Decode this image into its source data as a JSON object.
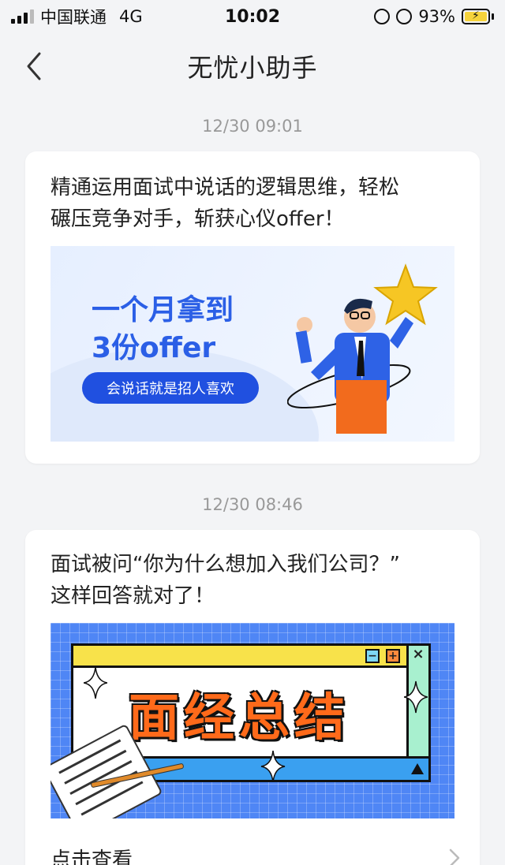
{
  "status_bar": {
    "carrier": "中国联通",
    "network": "4G",
    "time": "10:02",
    "battery": "93%"
  },
  "nav": {
    "title": "无忧小助手",
    "back_icon": "chevron-left-icon"
  },
  "messages": [
    {
      "timestamp": "12/30 09:01",
      "text_line1": "精通运用面试中说话的逻辑思维，轻松",
      "text_line2": "碾压竞争对手，斩获心仪offer！",
      "banner": {
        "headline1": "一个月拿到",
        "headline2": "3份offer",
        "pill": "会说话就是招人喜欢"
      }
    },
    {
      "timestamp": "12/30 08:46",
      "text_line1": "面试被问“你为什么想加入我们公司？”",
      "text_line2": "这样回答就对了！",
      "banner": {
        "title": "面经总结",
        "btn_minus": "−",
        "btn_plus": "+",
        "btn_close": "×"
      },
      "footer_label": "点击查看"
    }
  ],
  "colors": {
    "accent": "#2b5fe6",
    "background": "#f3f4f6"
  }
}
